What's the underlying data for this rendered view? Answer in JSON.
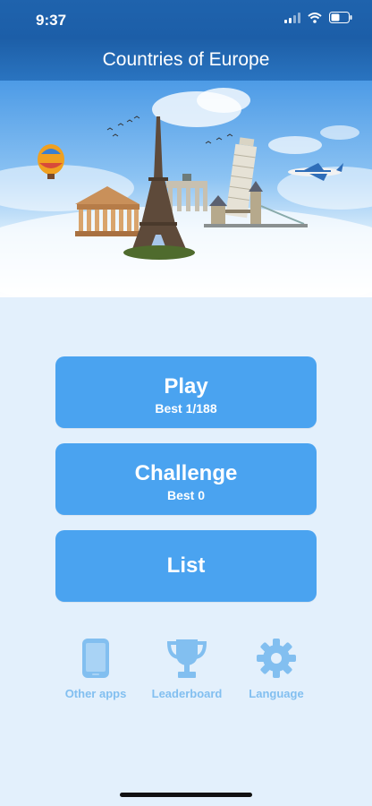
{
  "status": {
    "time": "9:37"
  },
  "nav": {
    "title": "Countries of Europe"
  },
  "menu": {
    "play": {
      "label": "Play",
      "sub": "Best 1/188"
    },
    "challenge": {
      "label": "Challenge",
      "sub": "Best 0"
    },
    "list": {
      "label": "List"
    }
  },
  "bottom": {
    "other_apps": "Other apps",
    "leaderboard": "Leaderboard",
    "language": "Language"
  },
  "colors": {
    "header": "#1d5fa8",
    "button": "#4aa3f0",
    "background": "#e3f0fc",
    "bottom_icon": "#82bff0"
  },
  "icons": [
    "signal-icon",
    "wifi-icon",
    "battery-icon",
    "phone-icon",
    "trophy-icon",
    "gear-icon"
  ]
}
